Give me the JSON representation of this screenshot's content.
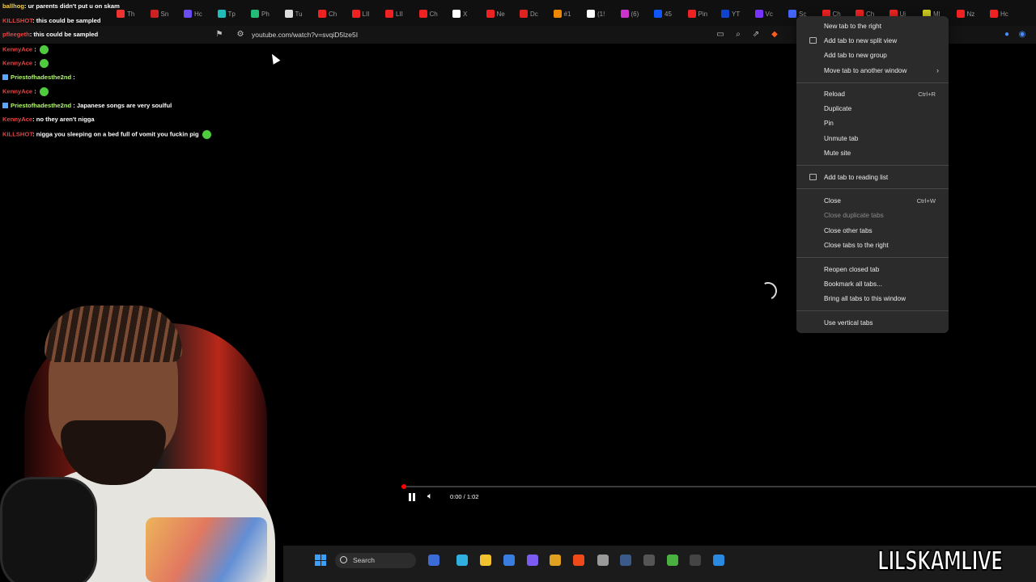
{
  "chat": [
    {
      "user": "ballhog",
      "msg": ": ur parents didn't put u on skam",
      "color": "yellow"
    },
    {
      "user": "KILLSHOT",
      "msg": ": this could be sampled",
      "color": "red"
    },
    {
      "user": "pfleegeth",
      "msg": ": this could be sampled",
      "color": "red"
    },
    {
      "user": "KennyAce",
      "msg": " :",
      "color": "red",
      "emote": true
    },
    {
      "user": "KennyAce",
      "msg": " :",
      "color": "red",
      "emote": true
    },
    {
      "user": "Priestofhadesthe2nd",
      "msg": " :",
      "color": "green"
    },
    {
      "user": "KennyAce",
      "msg": " :",
      "color": "red",
      "emote": true
    },
    {
      "user": "Priestofhadesthe2nd",
      "msg": " : Japanese songs are very soulful",
      "color": "green"
    },
    {
      "user": "KennyAce",
      "msg": ": no they aren't nigga",
      "color": "red"
    },
    {
      "user": "KILLSHOT",
      "msg": ": nigga you sleeping on a bed full of vomit you fuckin pig",
      "color": "red",
      "emote": true
    }
  ],
  "tabs": [
    "Th",
    "Sn",
    "Hc",
    "Tp",
    "Ph",
    "Tu",
    "Ch",
    "LII",
    "LII",
    "Ch",
    "X",
    "Ne",
    "Dc",
    "#1",
    "(1!",
    "(6)",
    "45",
    "Pin",
    "YT",
    "Vc",
    "Sc",
    "Ch",
    "Ch",
    "Ui",
    "Ml",
    "Nz",
    "Hc"
  ],
  "toolbar": {
    "url": "youtube.com/watch?v=svqiD5lze5I"
  },
  "player": {
    "time": "0:00 / 1:02",
    "progress": 0.0
  },
  "taskbar": {
    "search": "Search"
  },
  "watermark": "LILSKAMLIVE",
  "menu": {
    "new_tab_right": "New tab to the right",
    "split_view": "Add tab to new split view",
    "new_group": "Add tab to new group",
    "move_window": "Move tab to another window",
    "reload": "Reload",
    "reload_sc": "Ctrl+R",
    "duplicate": "Duplicate",
    "pin": "Pin",
    "unmute_tab": "Unmute tab",
    "mute_site": "Mute site",
    "reading_list": "Add tab to reading list",
    "close": "Close",
    "close_sc": "Ctrl+W",
    "close_duplicate": "Close duplicate tabs",
    "close_other": "Close other tabs",
    "close_right": "Close tabs to the right",
    "reopen": "Reopen closed tab",
    "bookmark_all": "Bookmark all tabs...",
    "bring_all": "Bring all tabs to this window",
    "vertical_tabs": "Use vertical tabs"
  }
}
